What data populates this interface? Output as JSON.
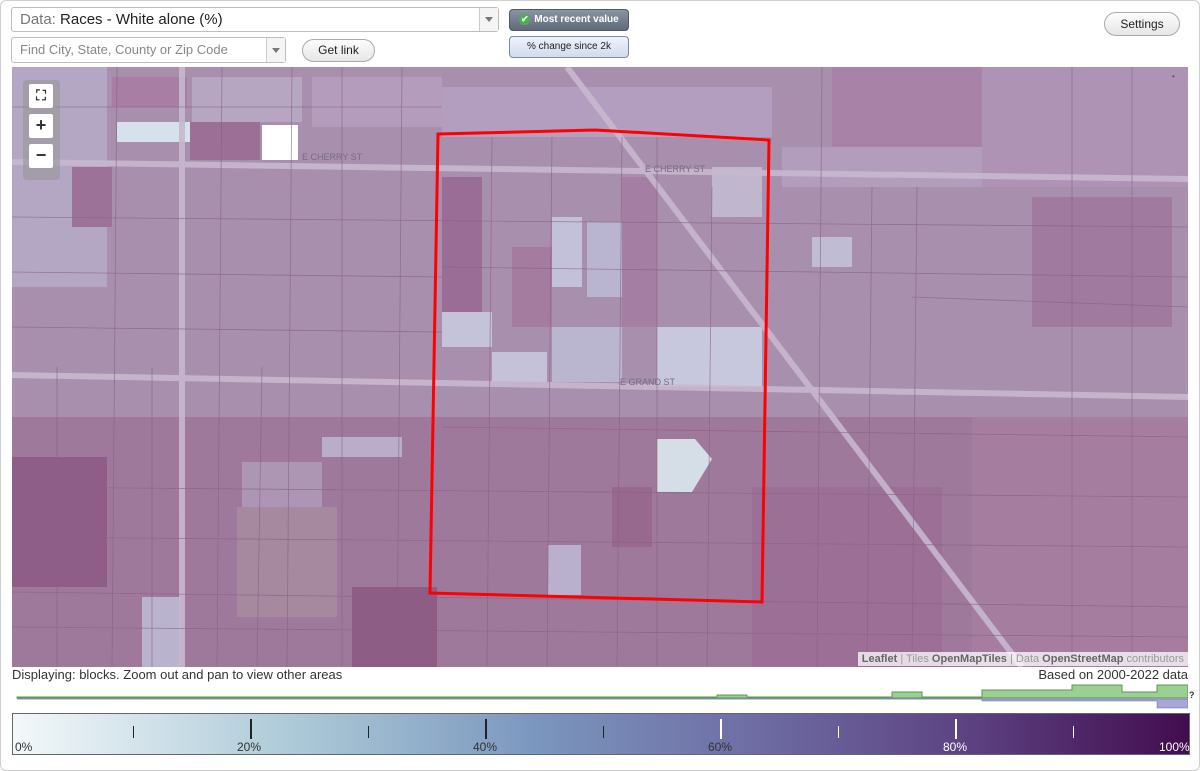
{
  "header": {
    "data_prefix": "Data:",
    "data_value": "Races - White alone (%)",
    "search_placeholder": "Find City, State, County or Zip Code",
    "get_link": "Get link",
    "settings": "Settings",
    "mode_active": "Most recent value",
    "mode_inactive": "% change since 2k"
  },
  "map": {
    "street_labels": [
      "E CHERRY ST",
      "E CHERRY ST",
      "E GRAND ST"
    ],
    "zoom_in": "+",
    "zoom_out": "−",
    "attribution": {
      "leaflet": "Leaflet",
      "sep1": " | Tiles ",
      "tiles": "OpenMapTiles",
      "sep2": " | Data ",
      "data": "OpenStreetMap",
      "contrib": " contributors"
    },
    "colors": {
      "selection": "#ff0000",
      "base": "#a98fae"
    }
  },
  "footer": {
    "displaying": "Displaying: blocks. Zoom out and pan to view other areas",
    "based_on": "Based on 2000-2022 data",
    "help": "?"
  },
  "legend": {
    "labels": [
      "0%",
      "20%",
      "40%",
      "60%",
      "80%",
      "100%"
    ]
  }
}
